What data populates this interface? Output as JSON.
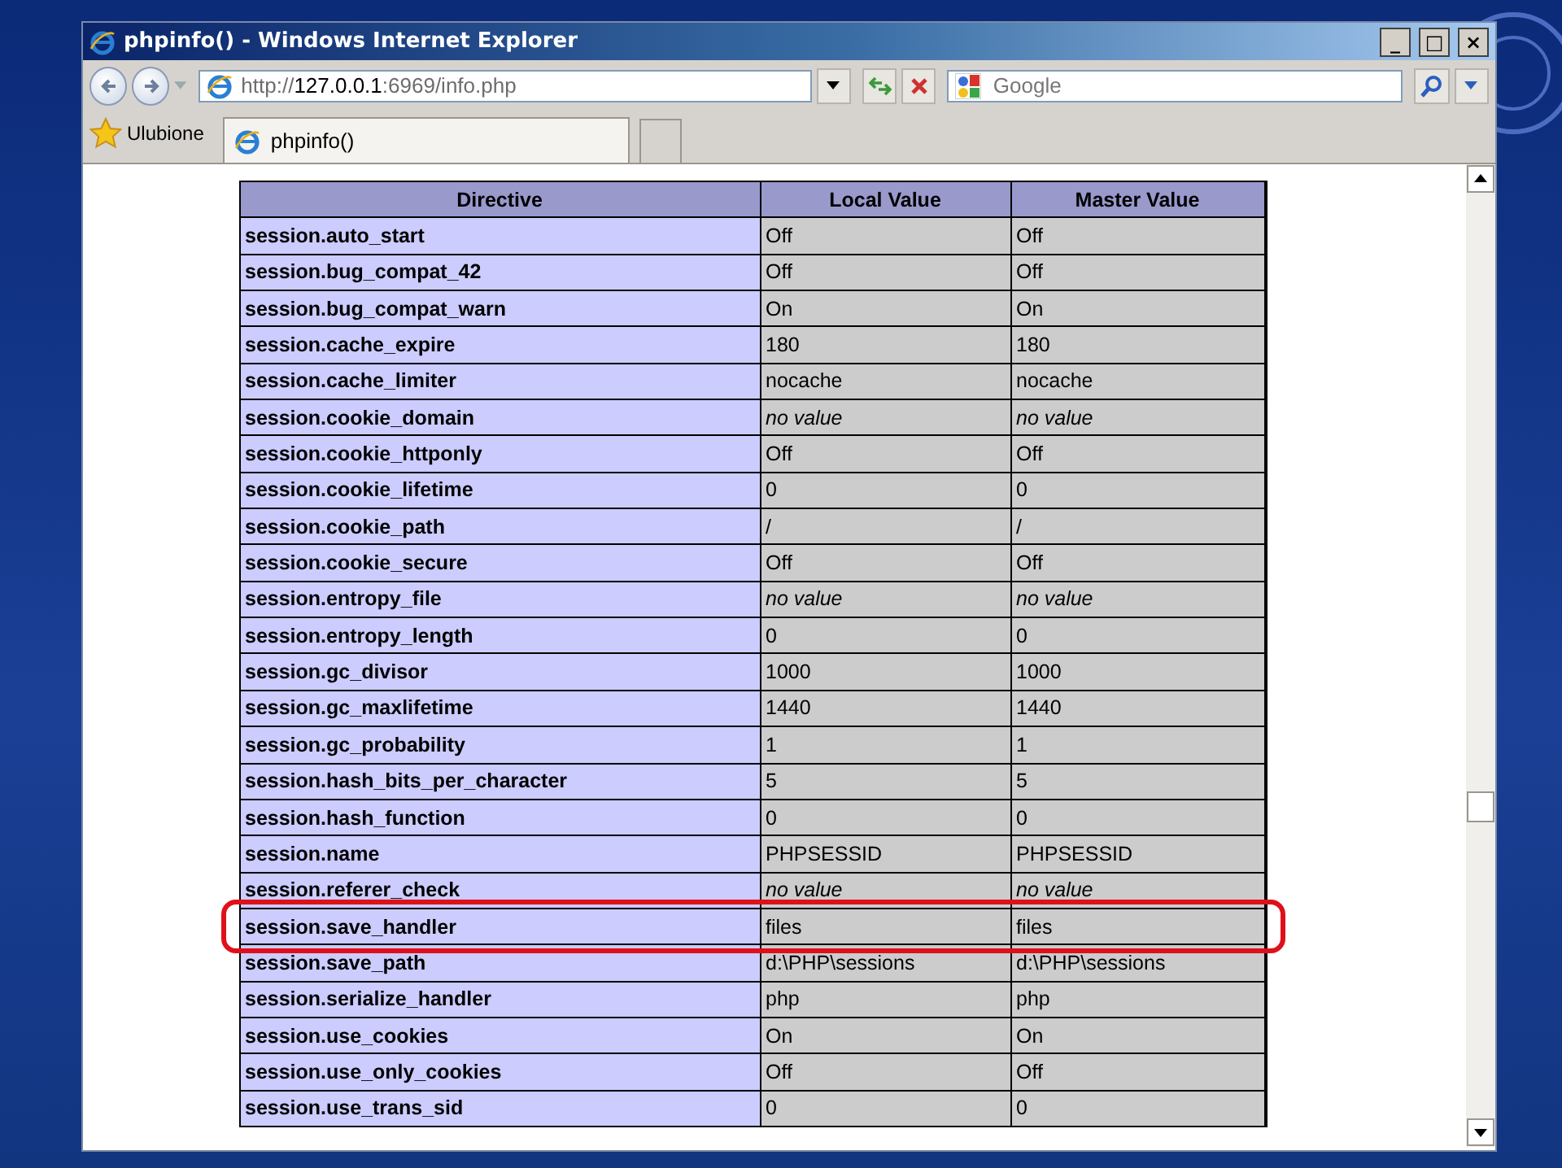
{
  "window": {
    "title": "phpinfo() - Windows Internet Explorer",
    "controls": [
      "_",
      "□",
      "×"
    ]
  },
  "address_bar": {
    "url": "http://**127.0.0.1**:6969/info.php"
  },
  "search": {
    "placeholder": "Google"
  },
  "favorites": {
    "label": "Ulubione"
  },
  "tabs": [
    {
      "label": "phpinfo()",
      "selected": true
    }
  ],
  "table": {
    "columns": [
      "Directive",
      "Local Value",
      "Master Value"
    ],
    "rows": [
      {
        "directive": "session.auto_start",
        "local": "Off",
        "master": "Off",
        "italic": false,
        "highlighted": false
      },
      {
        "directive": "session.bug_compat_42",
        "local": "Off",
        "master": "Off",
        "italic": false,
        "highlighted": false
      },
      {
        "directive": "session.bug_compat_warn",
        "local": "On",
        "master": "On",
        "italic": false,
        "highlighted": false
      },
      {
        "directive": "session.cache_expire",
        "local": "180",
        "master": "180",
        "italic": false,
        "highlighted": false
      },
      {
        "directive": "session.cache_limiter",
        "local": "nocache",
        "master": "nocache",
        "italic": false,
        "highlighted": false
      },
      {
        "directive": "session.cookie_domain",
        "local": "no value",
        "master": "no value",
        "italic": true,
        "highlighted": false
      },
      {
        "directive": "session.cookie_httponly",
        "local": "Off",
        "master": "Off",
        "italic": false,
        "highlighted": false
      },
      {
        "directive": "session.cookie_lifetime",
        "local": "0",
        "master": "0",
        "italic": false,
        "highlighted": false
      },
      {
        "directive": "session.cookie_path",
        "local": "/",
        "master": "/",
        "italic": false,
        "highlighted": false
      },
      {
        "directive": "session.cookie_secure",
        "local": "Off",
        "master": "Off",
        "italic": false,
        "highlighted": false
      },
      {
        "directive": "session.entropy_file",
        "local": "no value",
        "master": "no value",
        "italic": true,
        "highlighted": false
      },
      {
        "directive": "session.entropy_length",
        "local": "0",
        "master": "0",
        "italic": false,
        "highlighted": false
      },
      {
        "directive": "session.gc_divisor",
        "local": "1000",
        "master": "1000",
        "italic": false,
        "highlighted": false
      },
      {
        "directive": "session.gc_maxlifetime",
        "local": "1440",
        "master": "1440",
        "italic": false,
        "highlighted": false
      },
      {
        "directive": "session.gc_probability",
        "local": "1",
        "master": "1",
        "italic": false,
        "highlighted": false
      },
      {
        "directive": "session.hash_bits_per_character",
        "local": "5",
        "master": "5",
        "italic": false,
        "highlighted": false
      },
      {
        "directive": "session.hash_function",
        "local": "0",
        "master": "0",
        "italic": false,
        "highlighted": false
      },
      {
        "directive": "session.name",
        "local": "PHPSESSID",
        "master": "PHPSESSID",
        "italic": false,
        "highlighted": false
      },
      {
        "directive": "session.referer_check",
        "local": "no value",
        "master": "no value",
        "italic": true,
        "highlighted": false
      },
      {
        "directive": "session.save_handler",
        "local": "files",
        "master": "files",
        "italic": false,
        "highlighted": true
      },
      {
        "directive": "session.save_path",
        "local": "d:\\PHP\\sessions",
        "master": "d:\\PHP\\sessions",
        "italic": false,
        "highlighted": false
      },
      {
        "directive": "session.serialize_handler",
        "local": "php",
        "master": "php",
        "italic": false,
        "highlighted": false
      },
      {
        "directive": "session.use_cookies",
        "local": "On",
        "master": "On",
        "italic": false,
        "highlighted": false
      },
      {
        "directive": "session.use_only_cookies",
        "local": "Off",
        "master": "Off",
        "italic": false,
        "highlighted": false
      },
      {
        "directive": "session.use_trans_sid",
        "local": "0",
        "master": "0",
        "italic": false,
        "highlighted": false
      }
    ]
  }
}
